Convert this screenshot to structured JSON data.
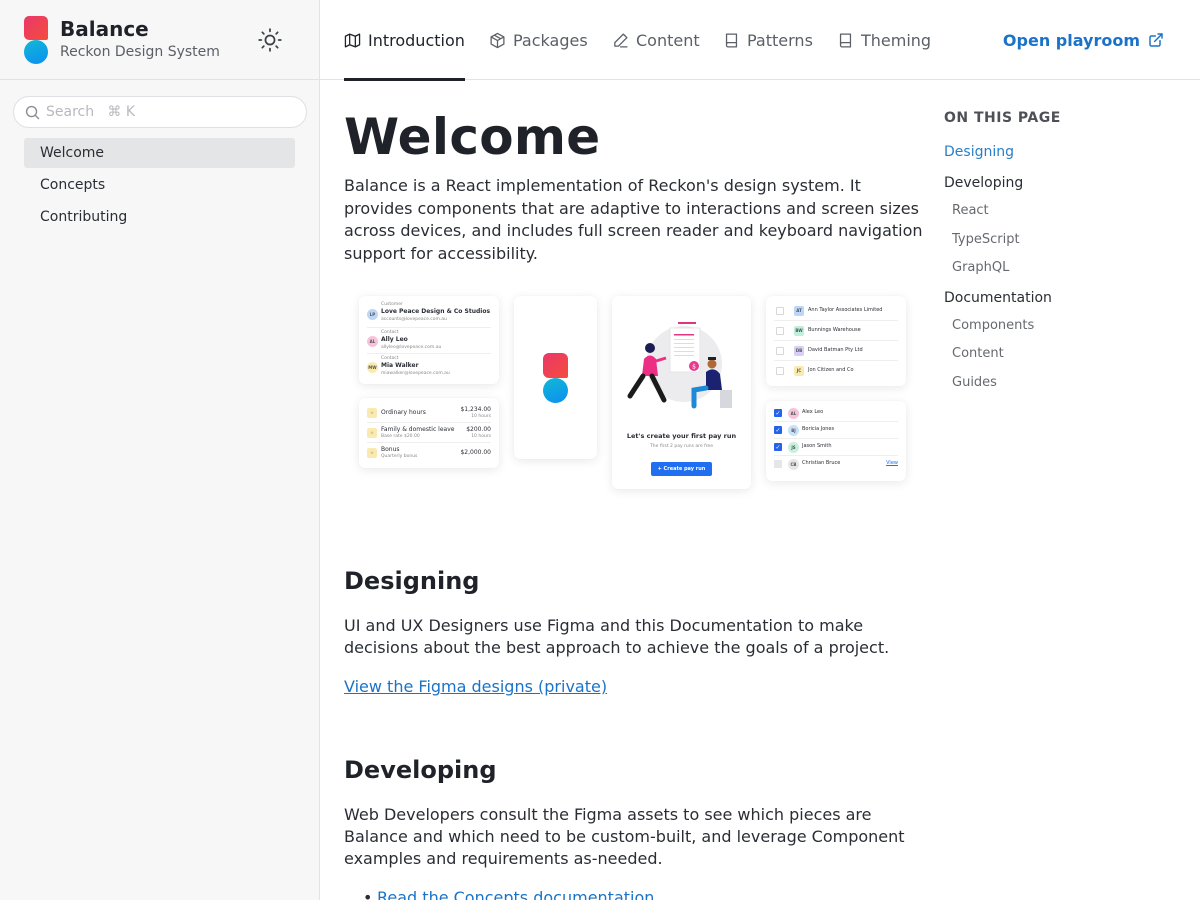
{
  "brand": {
    "title": "Balance",
    "subtitle": "Reckon Design System",
    "theme_toggle_icon": "sun-icon"
  },
  "search": {
    "placeholder": "Search   ⌘ K",
    "value": ""
  },
  "sidebar": {
    "items": [
      {
        "label": "Welcome",
        "active": true
      },
      {
        "label": "Concepts",
        "active": false
      },
      {
        "label": "Contributing",
        "active": false
      }
    ]
  },
  "topnav": {
    "tabs": [
      {
        "label": "Introduction",
        "icon": "map-icon",
        "active": true
      },
      {
        "label": "Packages",
        "icon": "package-icon",
        "active": false
      },
      {
        "label": "Content",
        "icon": "pencil-icon",
        "active": false
      },
      {
        "label": "Patterns",
        "icon": "book-icon",
        "active": false
      },
      {
        "label": "Theming",
        "icon": "book-icon",
        "active": false
      }
    ],
    "playroom_label": "Open playroom",
    "playroom_icon": "external-link-icon"
  },
  "main": {
    "title": "Welcome",
    "lead": "Balance is a React implementation of Reckon's design system. It provides components that are adaptive to interactions and screen sizes across devices, and includes full screen reader and keyboard navigation support for accessibility.",
    "hero": {
      "contacts": [
        {
          "role": "Customer",
          "name": "Love Peace Design & Co Studios",
          "email": "accounts@lovepeace.com.au",
          "initials": "LP",
          "color": "#bcd6f7"
        },
        {
          "role": "Contact",
          "name": "Ally Leo",
          "email": "allyleo@lovepeace.com.au",
          "initials": "AL",
          "color": "#f6c3dc"
        },
        {
          "role": "Contact",
          "name": "Mia Walker",
          "email": "miawalker@lovepeace.com.au",
          "initials": "MW",
          "color": "#fbeab0"
        }
      ],
      "pay_items": [
        {
          "label": "Ordinary hours",
          "sub": "",
          "amount": "$1,234.00",
          "amount_sub": "10 hours"
        },
        {
          "label": "Family & domestic leave",
          "sub": "Base rate $20.00",
          "amount": "$200.00",
          "amount_sub": "10 hours"
        },
        {
          "label": "Bonus",
          "sub": "Quarterly bonus",
          "amount": "$2,000.00",
          "amount_sub": ""
        }
      ],
      "payrun": {
        "title": "Let's create your first pay run",
        "subtitle": "The first 2 pay runs are free",
        "button": "+ Create pay run"
      },
      "companies": [
        {
          "initials": "AT",
          "name": "Ann Taylor Associates Limited",
          "color": "#bcd6f7"
        },
        {
          "initials": "BW",
          "name": "Bunnings Warehouse",
          "color": "#bff0dc"
        },
        {
          "initials": "DB",
          "name": "David Batman Pty Ltd",
          "color": "#d9cff5"
        },
        {
          "initials": "JC",
          "name": "Jon Citizen and Co",
          "color": "#fbeab0"
        }
      ],
      "people": [
        {
          "initials": "AL",
          "name": "Alex Leo",
          "checked": true,
          "color": "#f6c3dc"
        },
        {
          "initials": "BJ",
          "name": "Boricia Jones",
          "checked": true,
          "color": "#c8e2f7"
        },
        {
          "initials": "JS",
          "name": "Jason Smith",
          "checked": true,
          "color": "#c9f0dc"
        },
        {
          "initials": "CB",
          "name": "Christian Bruce",
          "checked": false,
          "color": "#e6e6e6",
          "action": "View"
        }
      ]
    },
    "designing": {
      "heading": "Designing",
      "text": "UI and UX Designers use Figma and this Documentation to make decisions about the best approach to achieve the goals of a project.",
      "link": "View the Figma designs (private)"
    },
    "developing": {
      "heading": "Developing",
      "text": "Web Developers consult the Figma assets to see which pieces are Balance and which need to be custom-built, and leverage Component examples and requirements as-needed.",
      "links": [
        "Read the Concepts documentation"
      ]
    }
  },
  "toc": {
    "title": "ON THIS PAGE",
    "items": [
      {
        "label": "Designing",
        "level": 1,
        "active": true
      },
      {
        "label": "Developing",
        "level": 1,
        "active": false
      },
      {
        "label": "React",
        "level": 2,
        "active": false
      },
      {
        "label": "TypeScript",
        "level": 2,
        "active": false
      },
      {
        "label": "GraphQL",
        "level": 2,
        "active": false
      },
      {
        "label": "Documentation",
        "level": 1,
        "active": false
      },
      {
        "label": "Components",
        "level": 2,
        "active": false
      },
      {
        "label": "Content",
        "level": 2,
        "active": false
      },
      {
        "label": "Guides",
        "level": 2,
        "active": false
      }
    ]
  },
  "colors": {
    "accent": "#1a73c8",
    "text": "#1f2329",
    "sidebar_bg": "#f7f7f8",
    "logo_red": "#f0415a",
    "logo_blue": "#0fa5e6"
  }
}
